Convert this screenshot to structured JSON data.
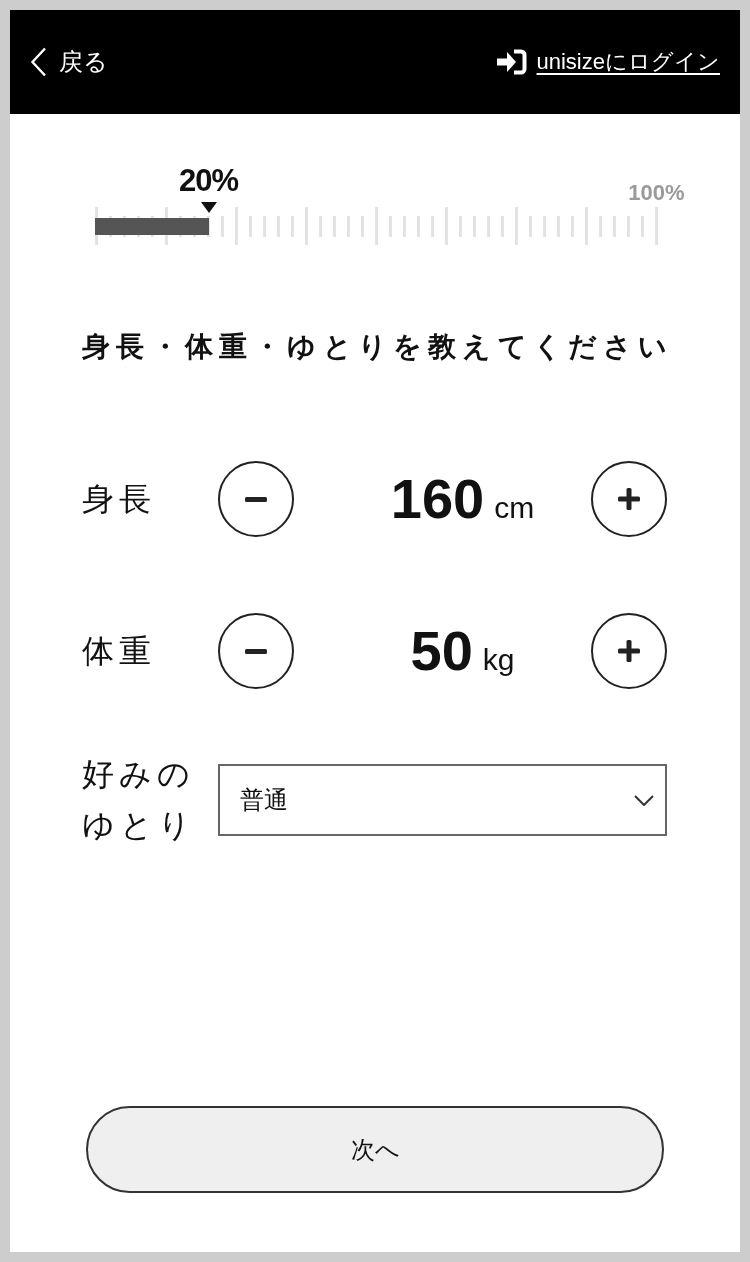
{
  "header": {
    "back_label": "戻る",
    "login_label": "unisizeにログイン"
  },
  "progress": {
    "level": 0.2,
    "reading": "20%",
    "max_label": "100%"
  },
  "title": "身長・体重・ゆとりを教えてください",
  "fields": [
    {
      "kind": "stepper",
      "label": "身長",
      "value": "160",
      "unit": "cm"
    },
    {
      "kind": "stepper",
      "label": "体重",
      "value": "50",
      "unit": "kg"
    },
    {
      "kind": "select",
      "label": "好みのゆとり",
      "value": "普通"
    }
  ],
  "next_button": "次へ"
}
